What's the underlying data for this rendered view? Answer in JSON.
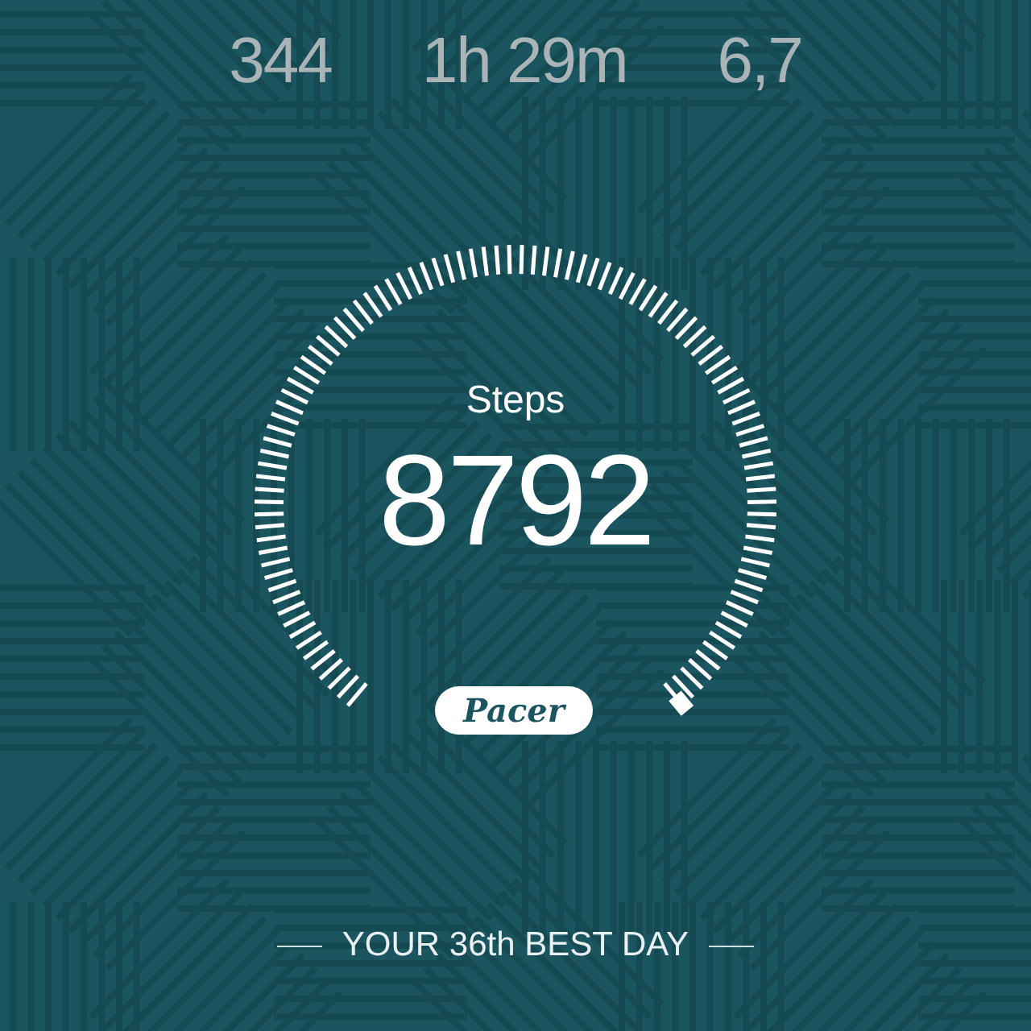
{
  "stats": [
    "344",
    "1h 29m",
    "6,7"
  ],
  "gauge": {
    "label": "Steps",
    "value": "8792"
  },
  "badge": "Pacer",
  "footer": "YOUR 36th BEST DAY"
}
